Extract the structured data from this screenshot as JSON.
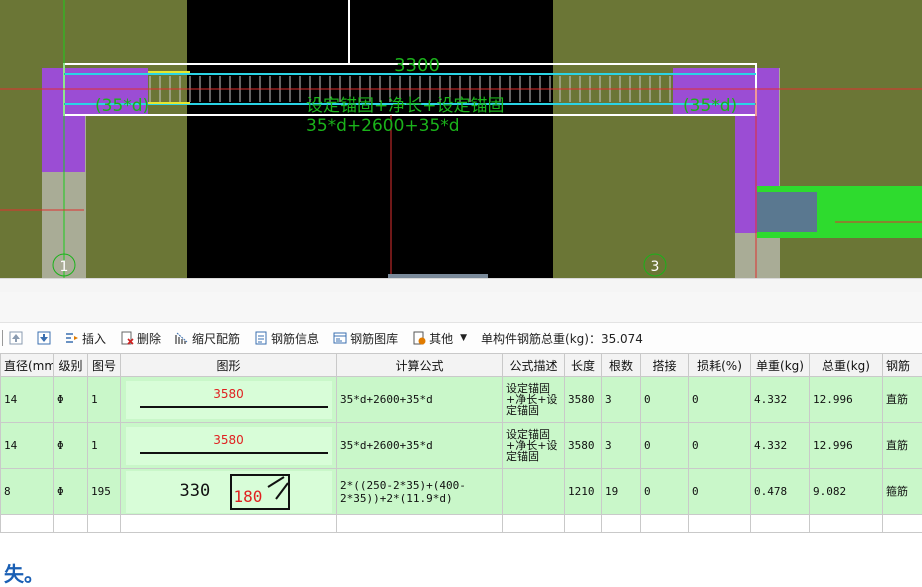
{
  "drawing": {
    "dimension": "3300",
    "anchor_left": "(35*d)",
    "anchor_right": "(35*d)",
    "formula_desc": "设定锚固+净长+设定锚固",
    "formula": "35*d+2600+35*d",
    "axis_left": "1",
    "axis_right": "3"
  },
  "toolbar": {
    "insert": "插入",
    "delete": "删除",
    "scale_rebar": "缩尺配筋",
    "rebar_info": "钢筋信息",
    "rebar_library": "钢筋图库",
    "other": "其他",
    "total_weight": "单构件钢筋总重(kg)：35.074"
  },
  "columns": [
    "直径(mm)",
    "级别",
    "图号",
    "图形",
    "计算公式",
    "公式描述",
    "长度",
    "根数",
    "搭接",
    "损耗(%)",
    "单重(kg)",
    "总重(kg)",
    "钢筋"
  ],
  "rows": [
    {
      "diameter": "14",
      "grade": "Φ",
      "fig_no": "1",
      "shape_value": "3580",
      "formula": "35*d+2600+35*d",
      "desc": "设定锚固+净长+设定锚固",
      "length": "3580",
      "count": "3",
      "lap": "0",
      "loss": "0",
      "unit_weight": "4.332",
      "total_weight": "12.996",
      "type": "直筋"
    },
    {
      "diameter": "14",
      "grade": "Φ",
      "fig_no": "1",
      "shape_value": "3580",
      "formula": "35*d+2600+35*d",
      "desc": "设定锚固+净长+设定锚固",
      "length": "3580",
      "count": "3",
      "lap": "0",
      "loss": "0",
      "unit_weight": "4.332",
      "total_weight": "12.996",
      "type": "直筋"
    },
    {
      "diameter": "8",
      "grade": "Φ",
      "fig_no": "195",
      "shape_value_a": "330",
      "shape_value_b": "180",
      "formula": "2*((250-2*35)+(400-2*35))+2*(11.9*d)",
      "desc": "",
      "length": "1210",
      "count": "19",
      "lap": "0",
      "loss": "0",
      "unit_weight": "0.478",
      "total_weight": "9.082",
      "type": "箍筋"
    }
  ],
  "bottom_text": "失。"
}
